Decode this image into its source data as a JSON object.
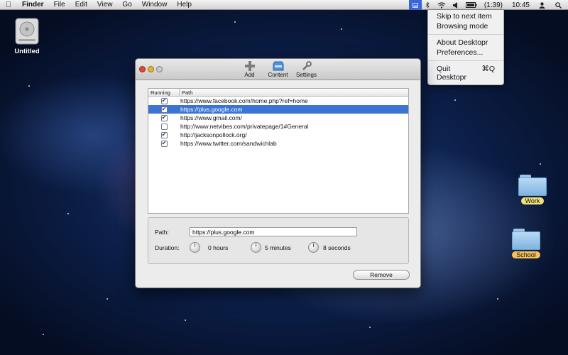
{
  "menubar": {
    "app_menu": "Finder",
    "menus": [
      "File",
      "Edit",
      "View",
      "Go",
      "Window",
      "Help"
    ],
    "battery": "(1:39)",
    "clock": "10:45"
  },
  "dropdown": {
    "items": [
      {
        "label": "Skip to next item"
      },
      {
        "label": "Browsing mode"
      },
      {
        "label": "About Desktopr"
      },
      {
        "label": "Preferences..."
      },
      {
        "label": "Quit Desktopr",
        "shortcut": "⌘Q"
      }
    ]
  },
  "desktop": {
    "drive_label": "Untitled",
    "folder_work": "Work",
    "folder_school": "School",
    "work_tag_color": "#f3e27a",
    "school_tag_color": "#f5c05a"
  },
  "window": {
    "toolbar": {
      "add": "Add",
      "content": "Content",
      "settings": "Settings"
    },
    "table": {
      "col_running": "Running",
      "col_path": "Path",
      "rows": [
        {
          "path": "https://www.facebook.com/home.php?ref=home",
          "running": true
        },
        {
          "path": "https://plus.google.com",
          "running": true
        },
        {
          "path": "https://www.gmail.com/",
          "running": true
        },
        {
          "path": "http://www.netvibes.com/privatepage/1#General",
          "running": false
        },
        {
          "path": "http://jacksonpollock.org/",
          "running": true
        },
        {
          "path": "https://www.twitter.com/sandwichlab",
          "running": true
        }
      ]
    },
    "details": {
      "path_label": "Path:",
      "path_value": "https://plus.google.com",
      "duration_label": "Duration:",
      "hours": "0 hours",
      "minutes": "5 minutes",
      "seconds": "8 seconds"
    },
    "remove_label": "Remove"
  },
  "colors": {
    "selection": "#3b74d5",
    "accent": "#3a66d6"
  }
}
